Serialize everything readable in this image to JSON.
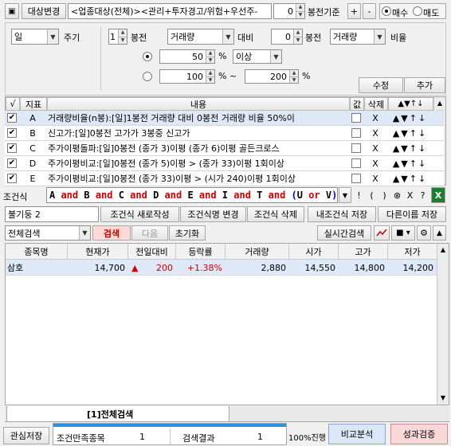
{
  "top": {
    "target_change_btn": "대상변경",
    "target_field": "<업종대상(전체)><관리+투자경고/위험+우선주-",
    "candle_base_value": "0",
    "candle_base_label": "봉전기준",
    "plus": "+",
    "minus": "-",
    "buy_label": "매수",
    "sell_label": "매도"
  },
  "settings": {
    "period_value": "일",
    "period_label": "주기",
    "candle1_value": "1",
    "candle1_label": "봉전",
    "indicator1": "거래량",
    "vs_label": "대비",
    "candle2_value": "0",
    "candle2_label": "봉전",
    "indicator2": "거래량",
    "ratio_label": "비율",
    "ratio_value": "50",
    "ratio_unit": "%",
    "cond_value": "이상",
    "range_from": "100",
    "range_unit1": "% ~",
    "range_to": "200",
    "range_unit2": "%",
    "modify_btn": "수정",
    "add_btn": "추가"
  },
  "conditions": {
    "headers": [
      "√",
      "지표",
      "내용",
      "값",
      "삭제",
      "▲▼↑↓"
    ],
    "rows": [
      {
        "checked": "✔",
        "id": "A",
        "content": "거래량비율(n봉):[일]1봉전 거래량 대비 0봉전 거래량 비율 50%이",
        "delete": "X",
        "arrows": "▲▼↑↓"
      },
      {
        "checked": "✔",
        "id": "B",
        "content": "신고가:[일]0봉전 고가가 3봉중 신고가",
        "delete": "X",
        "arrows": "▲▼↑↓"
      },
      {
        "checked": "✔",
        "id": "C",
        "content": "주가이평돌파:[일]0봉전 (종가 3)이평 (종가 6)이평 골든크로스",
        "delete": "X",
        "arrows": "▲▼↑↓"
      },
      {
        "checked": "✔",
        "id": "D",
        "content": "주가이평비교:[일]0봉전 (종가 5)이평 > (종가 33)이평 1회이상",
        "delete": "X",
        "arrows": "▲▼↑↓"
      },
      {
        "checked": "✔",
        "id": "E",
        "content": "주가이평비교:[일]0봉전 (종가 33)이평 > (시가 240)이평 1회이상",
        "delete": "X",
        "arrows": "▲▼↑↓"
      }
    ]
  },
  "expression": {
    "label": "조건식",
    "tokens": [
      {
        "t": "A",
        "c": "#000"
      },
      {
        "t": " and ",
        "c": "#cc0000"
      },
      {
        "t": "B",
        "c": "#000"
      },
      {
        "t": " and ",
        "c": "#cc0000"
      },
      {
        "t": "C",
        "c": "#000"
      },
      {
        "t": " and ",
        "c": "#cc0000"
      },
      {
        "t": "D",
        "c": "#000"
      },
      {
        "t": " and ",
        "c": "#cc0000"
      },
      {
        "t": "E",
        "c": "#000"
      },
      {
        "t": " and ",
        "c": "#cc0000"
      },
      {
        "t": "I",
        "c": "#000"
      },
      {
        "t": " and ",
        "c": "#cc0000"
      },
      {
        "t": "T",
        "c": "#000"
      },
      {
        "t": " and ",
        "c": "#cc0000"
      },
      {
        "t": "(",
        "c": "#0000cc"
      },
      {
        "t": "U",
        "c": "#000"
      },
      {
        "t": " or ",
        "c": "#cc0000"
      },
      {
        "t": "V",
        "c": "#000"
      },
      {
        "t": ")",
        "c": "#0000cc"
      }
    ],
    "ops": [
      "!",
      "(",
      ")",
      "⊗",
      "X",
      "?"
    ]
  },
  "actions": {
    "name_field": "불기둥 2",
    "new_btn": "조건식 새로작성",
    "rename_btn": "조건식명 변경",
    "delete_btn": "조건식 삭제",
    "my_save_btn": "내조건식 저장",
    "save_as_btn": "다른이름 저장"
  },
  "search": {
    "scope": "전체검색",
    "search_btn": "검색",
    "next_btn": "다음",
    "reset_btn": "초기화",
    "realtime_btn": "실시간검색"
  },
  "results": {
    "columns": [
      "종목명",
      "현재가",
      "전일대비",
      "등락률",
      "거래량",
      "시가",
      "고가",
      "저가"
    ],
    "rows": [
      {
        "name": "삼호",
        "price": "14,700",
        "arrow": "▲",
        "change": "200",
        "rate": "+1.38%",
        "volume": "2,880",
        "open": "14,550",
        "high": "14,800",
        "low": "14,200"
      }
    ]
  },
  "tab": {
    "label": "[1]전체검색"
  },
  "bottom": {
    "watch_save": "관심저장",
    "match_label": "조건만족종목",
    "match_count": "1",
    "result_label": "검색결과",
    "result_count": "1",
    "progress": "100%진행",
    "progress_value": 1.0,
    "compare_btn": "비교분석",
    "verify_btn": "성과검증"
  },
  "colors": {
    "up": "#d40000",
    "selected_row": "#dfe8f6",
    "search_btn_bg": "#ffd8d8",
    "compare_bg": "#dbe7f8",
    "verify_bg": "#f8d8d8"
  }
}
